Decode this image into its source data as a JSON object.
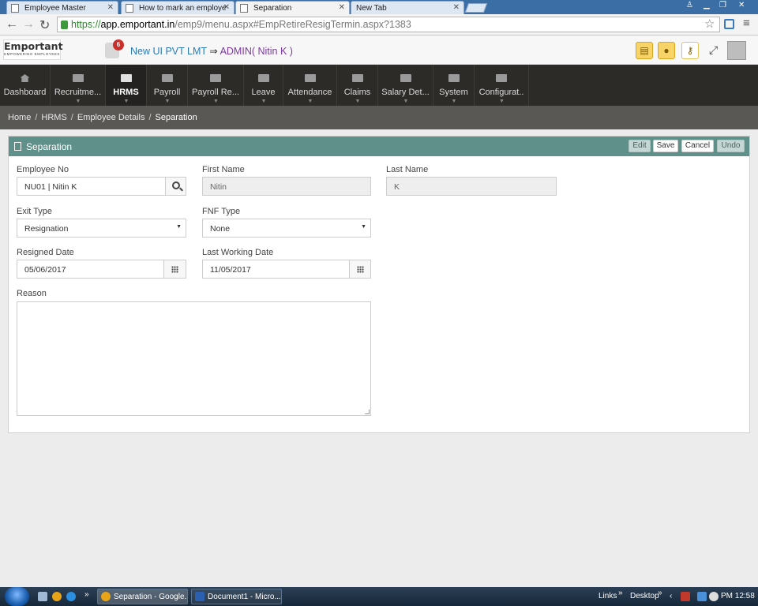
{
  "browser": {
    "tabs": [
      {
        "title": "Employee Master",
        "active": false
      },
      {
        "title": "How to mark an employe",
        "active": false
      },
      {
        "title": "Separation",
        "active": true
      },
      {
        "title": "New Tab",
        "active": false
      }
    ],
    "url": {
      "scheme": "https://",
      "host": "app.emportant.in",
      "path": "/emp9/menu.aspx#EmpRetireResigTermin.aspx?1383"
    }
  },
  "header": {
    "logo_line1": "Emportant",
    "logo_line2": "EMPOWERING EMPLOYEES",
    "notification_count": "6",
    "company": "New UI PVT LMT",
    "arrow": "⇒",
    "admin": "ADMIN( Nitin K )"
  },
  "nav": {
    "items": [
      {
        "label": "Dashboard",
        "icon": "home-icon"
      },
      {
        "label": "Recruitme...",
        "icon": "folder-icon"
      },
      {
        "label": "HRMS",
        "icon": "folder-icon",
        "active": true
      },
      {
        "label": "Payroll",
        "icon": "folder-icon"
      },
      {
        "label": "Payroll Re...",
        "icon": "folder-icon"
      },
      {
        "label": "Leave",
        "icon": "folder-icon"
      },
      {
        "label": "Attendance",
        "icon": "folder-icon"
      },
      {
        "label": "Claims",
        "icon": "folder-icon"
      },
      {
        "label": "Salary Det...",
        "icon": "folder-icon"
      },
      {
        "label": "System",
        "icon": "folder-icon"
      },
      {
        "label": "Configurat..",
        "icon": "folder-icon"
      }
    ]
  },
  "breadcrumb": {
    "home": "Home",
    "hrms": "HRMS",
    "employee_details": "Employee Details",
    "current": "Separation",
    "separator": "/"
  },
  "panel": {
    "title": "Separation",
    "buttons": {
      "edit": "Edit",
      "save": "Save",
      "cancel": "Cancel",
      "undo": "Undo"
    }
  },
  "form": {
    "employee_no": {
      "label": "Employee No",
      "value": "NU01 | Nitin K"
    },
    "first_name": {
      "label": "First Name",
      "value": "Nitin"
    },
    "last_name": {
      "label": "Last Name",
      "value": "K"
    },
    "exit_type": {
      "label": "Exit Type",
      "value": "Resignation"
    },
    "fnf_type": {
      "label": "FNF Type",
      "value": "None"
    },
    "resigned_date": {
      "label": "Resigned Date",
      "value": "05/06/2017"
    },
    "last_working_date": {
      "label": "Last Working Date",
      "value": "11/05/2017"
    },
    "reason": {
      "label": "Reason",
      "value": ""
    }
  },
  "taskbar": {
    "tasks": [
      {
        "label": "Separation - Google...",
        "active": true
      },
      {
        "label": "Document1 - Micro...",
        "active": false
      }
    ],
    "links": "Links",
    "desktop": "Desktop",
    "time": "PM 12:58"
  }
}
